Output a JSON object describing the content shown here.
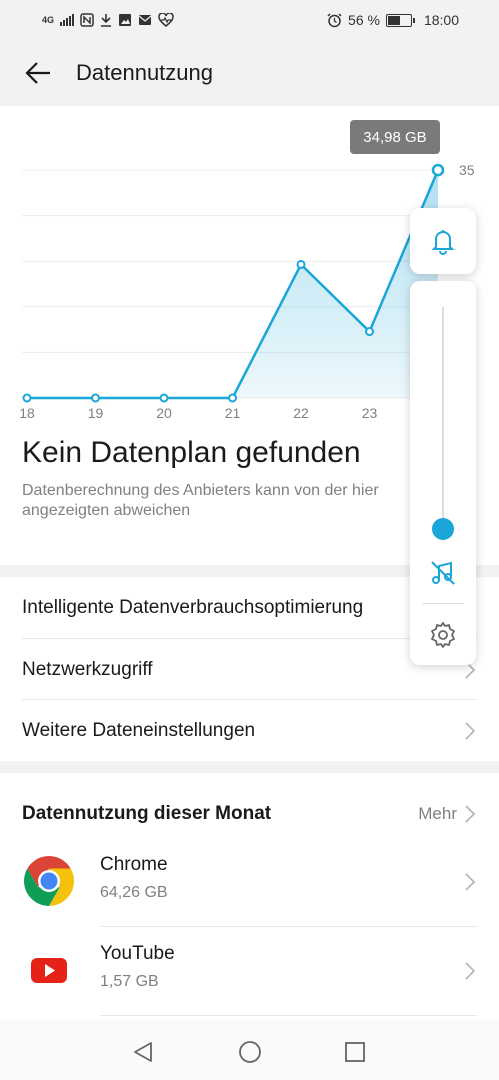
{
  "status_bar": {
    "network": "4G",
    "battery_percent_label": "56 %",
    "battery_level": 0.56,
    "time": "18:00",
    "icons": [
      "signal-icon",
      "nfc-icon",
      "download-icon",
      "gallery-icon",
      "mail-icon",
      "heart-icon",
      "alarm-icon",
      "battery-icon"
    ]
  },
  "header": {
    "title": "Datennutzung",
    "back_icon": "arrow-left-icon"
  },
  "chart_data": {
    "type": "area",
    "x": [
      "18",
      "19",
      "20",
      "21",
      "22",
      "23",
      "24"
    ],
    "values": [
      0,
      0,
      0,
      0,
      20.5,
      10.2,
      34.98
    ],
    "tick_labels": [
      "18",
      "19",
      "20",
      "21",
      "22",
      "23"
    ],
    "y_axis_max_label": "35",
    "ylim": [
      0,
      35
    ],
    "tooltip": "34,98 GB",
    "grid": true,
    "color": "#1aa6d8"
  },
  "plan": {
    "title": "Kein Datenplan gefunden",
    "subtitle": "Datenberechnung des Anbieters kann von der hier angezeigten abweichen"
  },
  "menu": [
    {
      "label": "Intelligente Datenverbrauchsoptimierung"
    },
    {
      "label": "Netzwerkzugriff"
    },
    {
      "label": "Weitere Dateneinstellungen"
    }
  ],
  "usage": {
    "title": "Datennutzung dieser Monat",
    "more_label": "Mehr",
    "apps": [
      {
        "name": "Chrome",
        "size": "64,26 GB",
        "icon": "chrome-icon"
      },
      {
        "name": "YouTube",
        "size": "1,57 GB",
        "icon": "youtube-icon"
      }
    ]
  },
  "volume": {
    "level": 0.05,
    "icons": [
      "bell-icon",
      "music-mute-icon",
      "gear-icon"
    ]
  },
  "navbar": {
    "icons": [
      "back-triangle-icon",
      "home-circle-icon",
      "recents-square-icon"
    ]
  },
  "colors": {
    "accent": "#1aa6d8",
    "tooltip_bg": "#7a7a7a",
    "divider": "#f2f2f2"
  }
}
